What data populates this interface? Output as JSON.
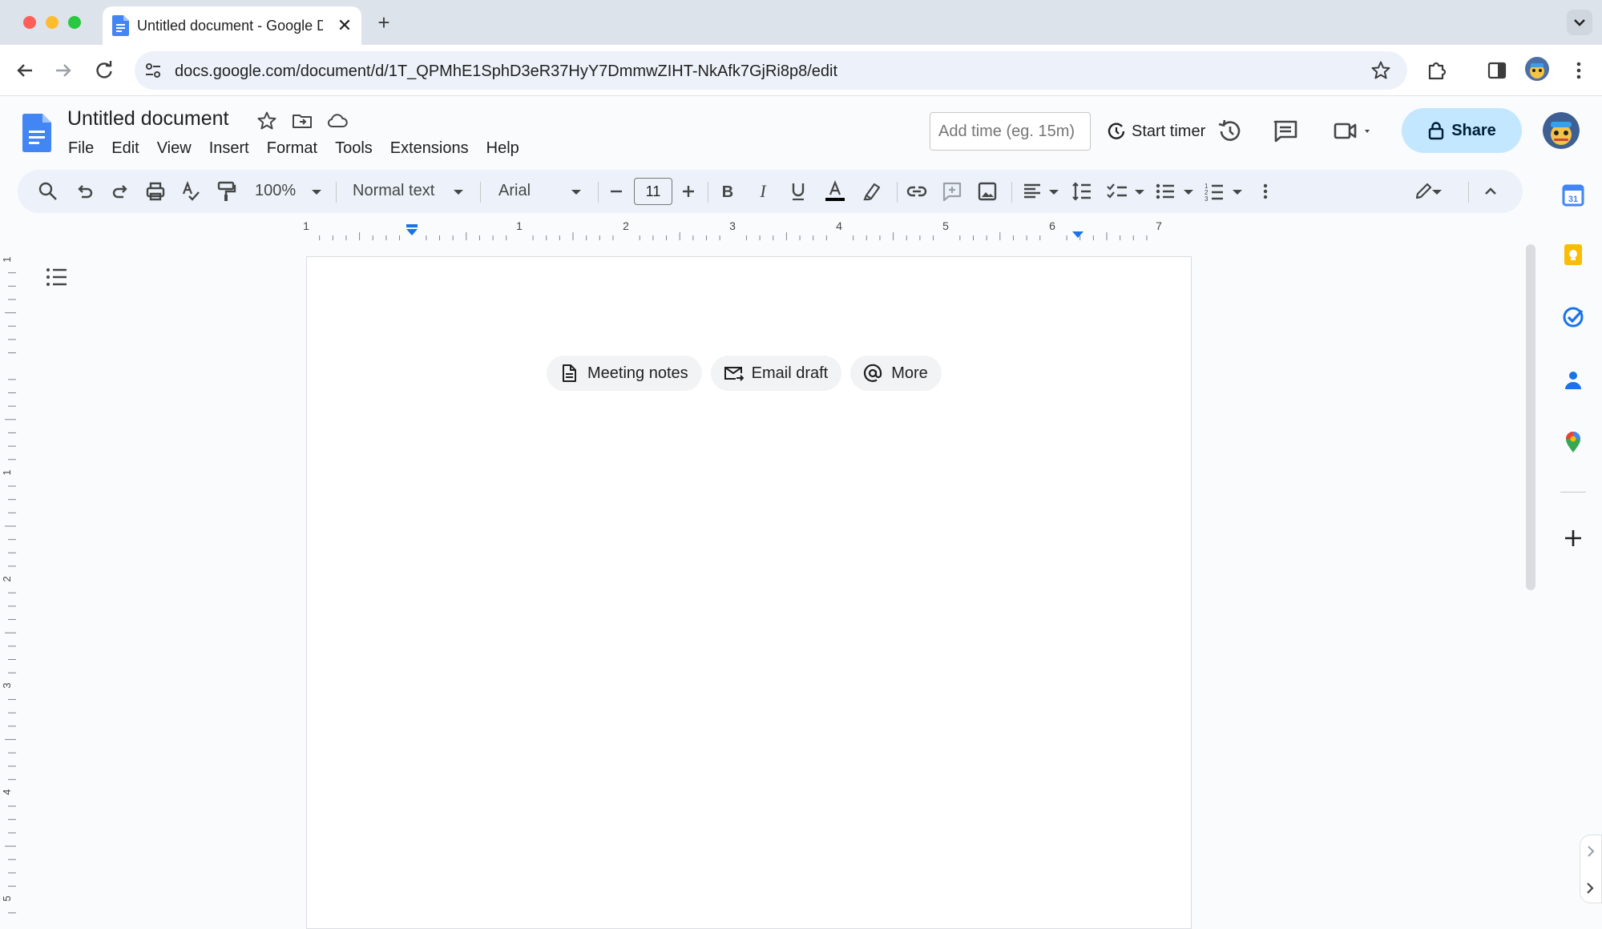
{
  "browser": {
    "tab_title": "Untitled document - Google Docs",
    "tab_title_visible": "Untitled document - Google D",
    "new_tab_symbol": "+",
    "close_symbol": "✕",
    "url": "docs.google.com/document/d/1T_QPMhE1SphD3eR37HyY7DmmwZIHT-NkAfk7GjRi8p8/edit"
  },
  "docs": {
    "title": "Untitled document",
    "menu": [
      "File",
      "Edit",
      "View",
      "Insert",
      "Format",
      "Tools",
      "Extensions",
      "Help"
    ],
    "time_input_placeholder": "Add time (eg. 15m)",
    "start_timer_label": "Start timer",
    "share_label": "Share"
  },
  "toolbar": {
    "zoom": "100%",
    "style": "Normal text",
    "font": "Arial",
    "font_size": "11"
  },
  "ruler": {
    "labels": [
      "1",
      "1",
      "2",
      "3",
      "4",
      "5",
      "6",
      "7"
    ],
    "vertical_labels": [
      "1",
      "1",
      "2",
      "3",
      "4",
      "5"
    ]
  },
  "chips": [
    {
      "label": "Meeting notes",
      "icon": "document-icon"
    },
    {
      "label": "Email draft",
      "icon": "email-icon"
    },
    {
      "label": "More",
      "icon": "at-sign-icon"
    }
  ],
  "colors": {
    "accent": "#1a73e8",
    "share_bg": "#c2e7ff",
    "toolbar_bg": "#edf2fa"
  }
}
